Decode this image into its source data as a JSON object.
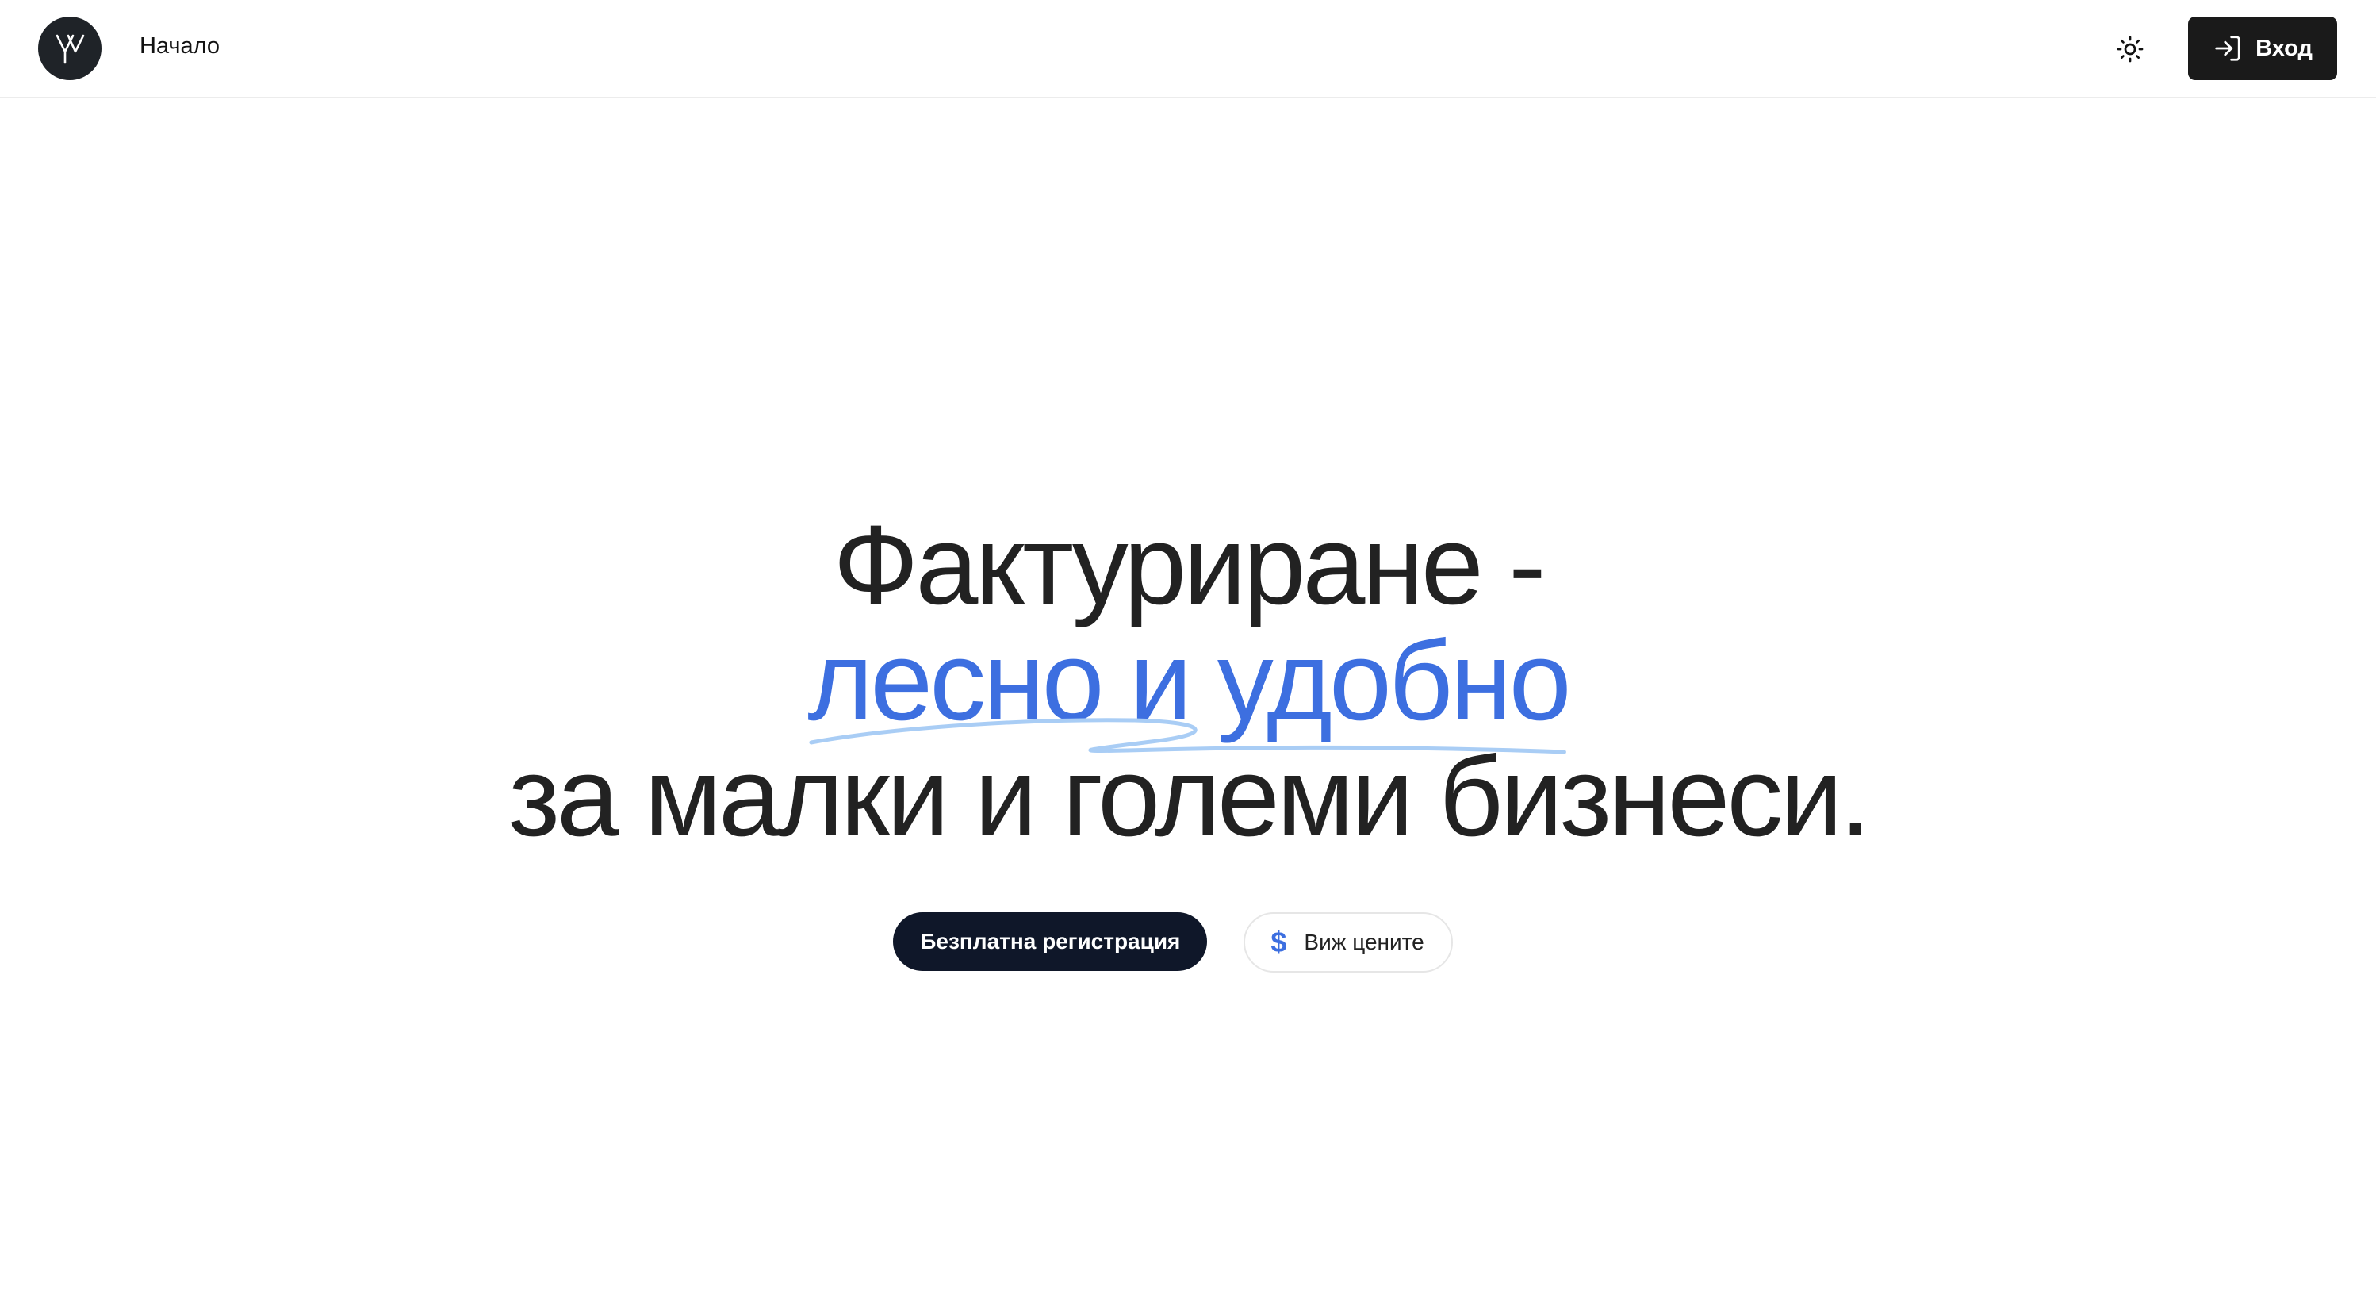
{
  "header": {
    "nav": {
      "home_label": "Начало"
    },
    "login_label": "Вход"
  },
  "hero": {
    "line1": "Фактуриране -",
    "line2": "лесно и удобно",
    "line3": "за малки и големи бизнеси."
  },
  "cta": {
    "register_label": "Безплатна регистрация",
    "pricing_label": "Виж цените",
    "pricing_icon": "$"
  },
  "colors": {
    "accent": "#3d6fe0",
    "dark_button": "#1a1a1a",
    "primary_cta": "#0f1729",
    "scribble": "#a9cdf5"
  },
  "icons": [
    "logo-icon",
    "sun-icon",
    "login-icon",
    "dollar-icon"
  ]
}
